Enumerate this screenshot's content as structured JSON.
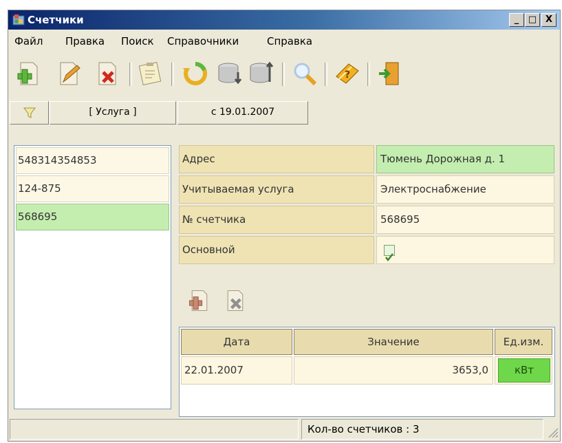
{
  "window": {
    "title": "Счетчики",
    "controls": {
      "minimize": "_",
      "maximize": "□",
      "close": "X"
    }
  },
  "menu": {
    "items": [
      "Файл",
      "Правка",
      "Поиск",
      "Справочники",
      "Справка"
    ]
  },
  "toolbar": {
    "icons": [
      "add-icon",
      "edit-icon",
      "delete-icon",
      "notes-icon",
      "refresh-icon",
      "db-import-icon",
      "db-export-icon",
      "search-icon",
      "help-book-icon",
      "exit-icon"
    ]
  },
  "filter": {
    "service_label": "[ Услуга ]",
    "date_label": "с 19.01.2007"
  },
  "meters": {
    "items": [
      "548314354853",
      "124-875",
      "568695"
    ],
    "selected_index": 2
  },
  "details": {
    "rows": [
      {
        "label": "Адрес",
        "value": "Тюмень Дорожная д. 1"
      },
      {
        "label": "Учитываемая услуга",
        "value": "Электроснабжение"
      },
      {
        "label": "№ счетчика",
        "value": "568695"
      },
      {
        "label": "Основной",
        "checked": true
      }
    ]
  },
  "readings": {
    "columns": [
      "Дата",
      "Значение",
      "Ед.изм."
    ],
    "rows": [
      {
        "date": "22.01.2007",
        "value": "3653,0",
        "unit": "кВт"
      }
    ]
  },
  "status": {
    "left": "",
    "count_text": "Кол-во счетчиков : 3"
  },
  "colors": {
    "title_start": "#0a246a",
    "title_end": "#a6caf0",
    "selected_green": "#c4eeb0",
    "label_tan": "#efe3b4",
    "value_cream": "#fdf6e0"
  }
}
